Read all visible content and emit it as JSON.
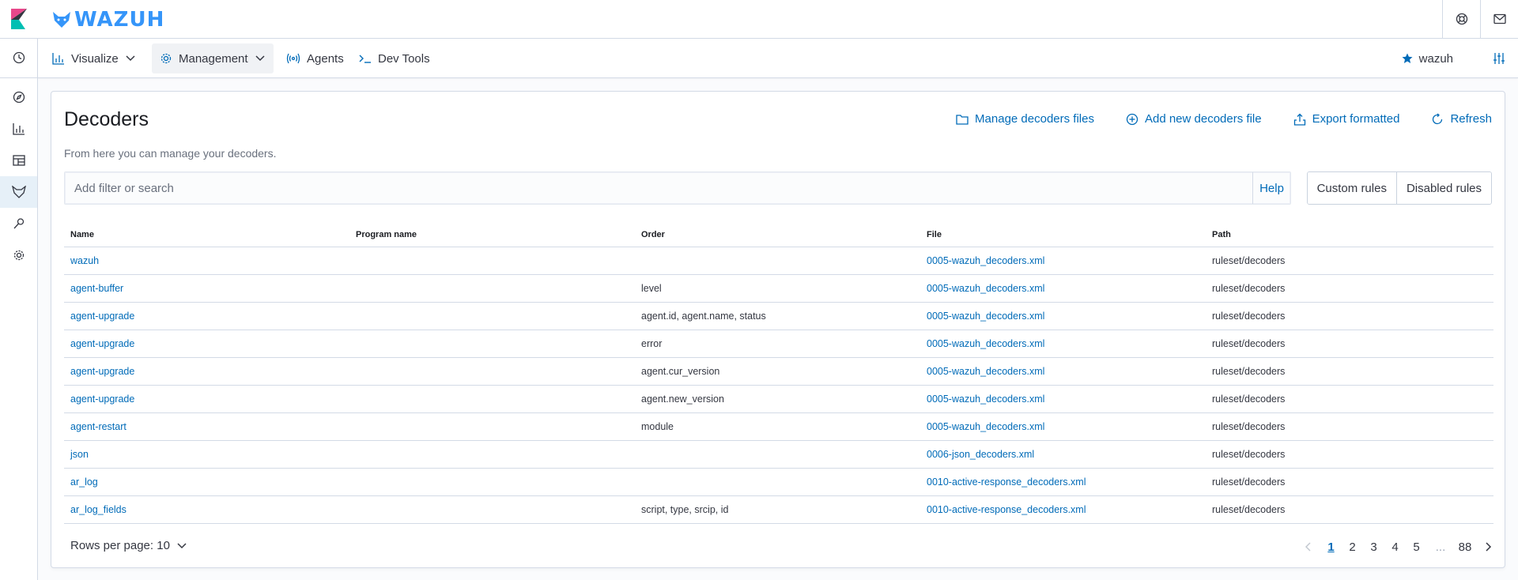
{
  "brand": {
    "name": "WAZUH"
  },
  "menu": {
    "items": [
      {
        "label": "Visualize",
        "icon": "chart-icon",
        "dropdown": true
      },
      {
        "label": "Management",
        "icon": "gear-icon",
        "dropdown": true,
        "active": true
      },
      {
        "label": "Agents",
        "icon": "antenna-icon",
        "dropdown": false
      },
      {
        "label": "Dev Tools",
        "icon": "console-icon",
        "dropdown": false
      }
    ],
    "user": "wazuh"
  },
  "page": {
    "title": "Decoders",
    "description": "From here you can manage your decoders.",
    "actions": {
      "manage": "Manage decoders files",
      "add": "Add new decoders file",
      "export": "Export formatted",
      "refresh": "Refresh"
    },
    "search": {
      "placeholder": "Add filter or search",
      "help": "Help"
    },
    "toggles": {
      "custom": "Custom rules",
      "disabled": "Disabled rules"
    }
  },
  "table": {
    "columns": [
      "Name",
      "Program name",
      "Order",
      "File",
      "Path"
    ],
    "rows": [
      {
        "name": "wazuh",
        "program": "",
        "order": "",
        "file": "0005-wazuh_decoders.xml",
        "path": "ruleset/decoders"
      },
      {
        "name": "agent-buffer",
        "program": "",
        "order": "level",
        "file": "0005-wazuh_decoders.xml",
        "path": "ruleset/decoders"
      },
      {
        "name": "agent-upgrade",
        "program": "",
        "order": "agent.id, agent.name, status",
        "file": "0005-wazuh_decoders.xml",
        "path": "ruleset/decoders"
      },
      {
        "name": "agent-upgrade",
        "program": "",
        "order": "error",
        "file": "0005-wazuh_decoders.xml",
        "path": "ruleset/decoders"
      },
      {
        "name": "agent-upgrade",
        "program": "",
        "order": "agent.cur_version",
        "file": "0005-wazuh_decoders.xml",
        "path": "ruleset/decoders"
      },
      {
        "name": "agent-upgrade",
        "program": "",
        "order": "agent.new_version",
        "file": "0005-wazuh_decoders.xml",
        "path": "ruleset/decoders"
      },
      {
        "name": "agent-restart",
        "program": "",
        "order": "module",
        "file": "0005-wazuh_decoders.xml",
        "path": "ruleset/decoders"
      },
      {
        "name": "json",
        "program": "",
        "order": "",
        "file": "0006-json_decoders.xml",
        "path": "ruleset/decoders"
      },
      {
        "name": "ar_log",
        "program": "",
        "order": "",
        "file": "0010-active-response_decoders.xml",
        "path": "ruleset/decoders"
      },
      {
        "name": "ar_log_fields",
        "program": "",
        "order": "script, type, srcip, id",
        "file": "0010-active-response_decoders.xml",
        "path": "ruleset/decoders"
      }
    ]
  },
  "pagination": {
    "rows_per_page": "Rows per page: 10",
    "pages": [
      "1",
      "2",
      "3",
      "4",
      "5",
      "...",
      "88"
    ],
    "current": "1"
  },
  "colors": {
    "accent": "#006bb8",
    "brand": "#3595f9",
    "kibana_pink": "#e8488b",
    "kibana_teal": "#00bfb3"
  }
}
